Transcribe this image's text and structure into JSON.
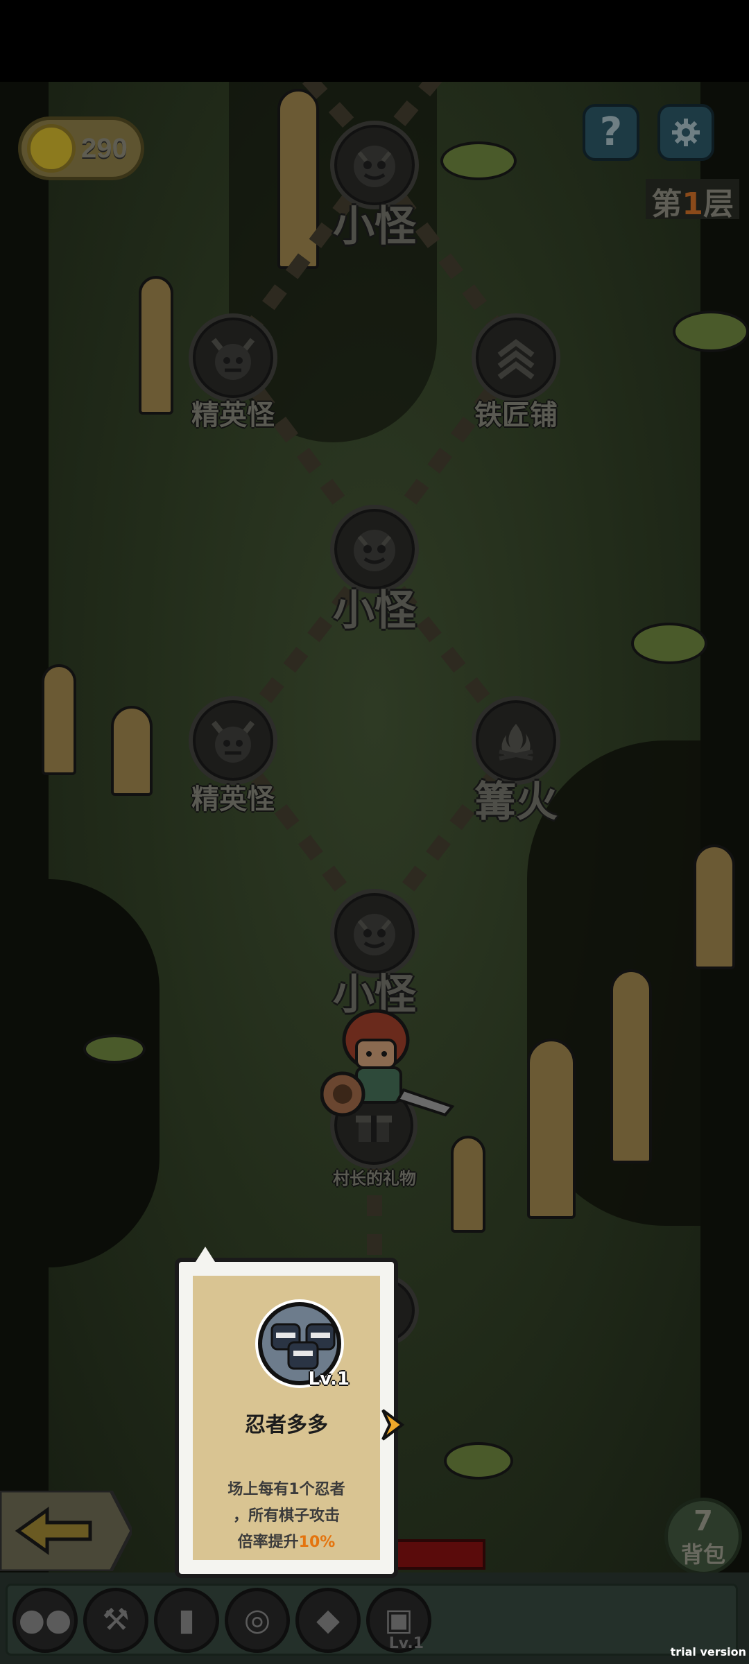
{
  "hud": {
    "coins": "290",
    "help_icon": "question-icon",
    "settings_icon": "gear-icon",
    "floor_prefix": "第",
    "floor_number": "1",
    "floor_suffix": "层"
  },
  "map": {
    "nodes": [
      {
        "id": "top-minion",
        "label": "小怪",
        "icon": "demon-icon",
        "size": "big"
      },
      {
        "id": "left-elite-1",
        "label": "精英怪",
        "icon": "horned-demon-icon",
        "size": "small"
      },
      {
        "id": "blacksmith",
        "label": "铁匠铺",
        "icon": "chevron-rank-icon",
        "size": "small"
      },
      {
        "id": "mid-minion",
        "label": "小怪",
        "icon": "demon-icon",
        "size": "big"
      },
      {
        "id": "left-elite-2",
        "label": "精英怪",
        "icon": "horned-demon-icon",
        "size": "small"
      },
      {
        "id": "bonfire",
        "label": "篝火",
        "icon": "campfire-icon",
        "size": "big"
      },
      {
        "id": "low-minion",
        "label": "小怪",
        "icon": "demon-icon",
        "size": "big"
      },
      {
        "id": "village-gift",
        "label": "村长的礼物",
        "icon": "gift-icon",
        "size": "tiny"
      }
    ]
  },
  "tooltip": {
    "level": "Lv.1",
    "name": "忍者多多",
    "desc_line1": "场上每有1个忍者",
    "desc_line2": "，所有棋子攻击",
    "desc_line3_prefix": "倍率提升",
    "desc_highlight": "10%",
    "portrait_icon": "ninja-trio-icon"
  },
  "bag": {
    "count": "7",
    "label": "背包"
  },
  "tray": {
    "relics": [
      {
        "icon": "beans-icon"
      },
      {
        "icon": "hammer-icon"
      },
      {
        "icon": "scroll-book-icon"
      },
      {
        "icon": "donut-icon"
      },
      {
        "icon": "purple-crystal-icon"
      },
      {
        "icon": "ninja-trio-icon",
        "level": "Lv.1"
      }
    ]
  },
  "watermark": "trial version",
  "colors": {
    "highlight": "#e4740e",
    "floor_number": "#8a4a1a",
    "tooltip_bg": "#d9c492"
  }
}
